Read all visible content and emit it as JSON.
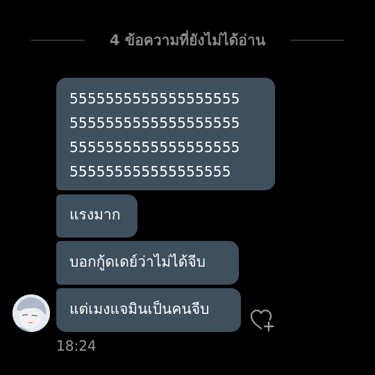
{
  "unread_divider": {
    "label": "4 ข้อความที่ยังไม่ได้อ่าน"
  },
  "messages": [
    {
      "lines": [
        "5555555555555555555",
        "5555555555555555555",
        "5555555555555555555",
        "555555555555555555"
      ]
    },
    {
      "text": "แรงมาก"
    },
    {
      "text": "บอกกู้ดเดย์ว่าไม่ได้จีบ"
    },
    {
      "text": "แต่เมงแจมินเป็นคนจีบ"
    }
  ],
  "timestamp": "18:24",
  "icons": {
    "avatar": "sender-avatar",
    "reaction": "heart-add-icon"
  },
  "colors": {
    "background": "#000000",
    "bubble": "#3e4f5e",
    "divider_text": "#8a8a8a",
    "timestamp": "#9a9a9a"
  }
}
